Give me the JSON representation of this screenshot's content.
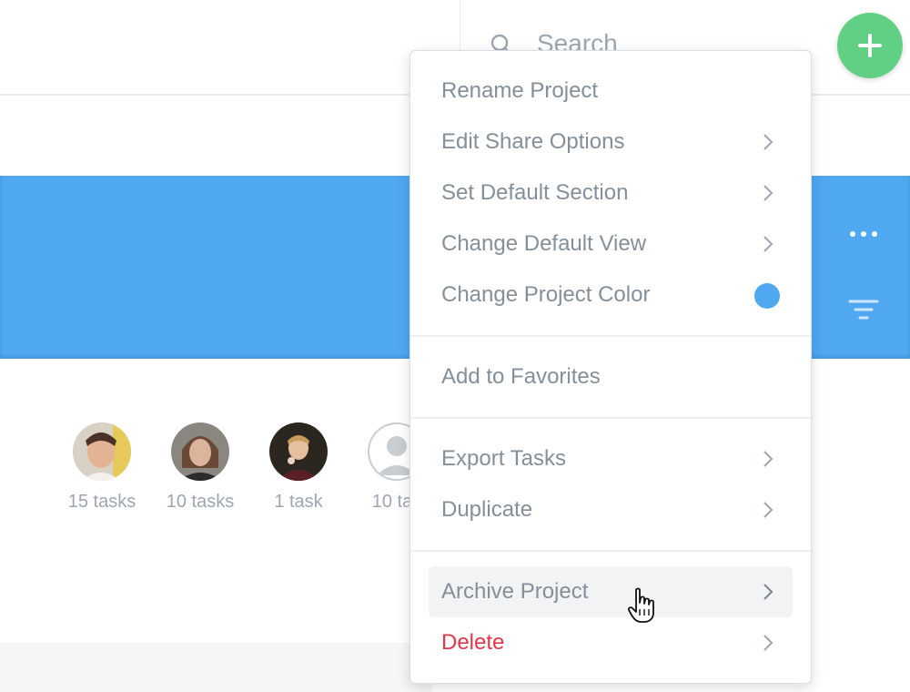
{
  "search": {
    "placeholder": "Search"
  },
  "members": [
    {
      "label": "15 tasks"
    },
    {
      "label": "10 tasks"
    },
    {
      "label": "1 task"
    },
    {
      "label": "10 tas"
    }
  ],
  "context_menu": {
    "rename": "Rename Project",
    "share": "Edit Share Options",
    "section": "Set Default Section",
    "view": "Change Default View",
    "color": "Change Project Color",
    "favorites": "Add to Favorites",
    "export": "Export Tasks",
    "duplicate": "Duplicate",
    "archive": "Archive Project",
    "delete": "Delete"
  },
  "colors": {
    "project_color": "#4fa8f0",
    "fab": "#62d084",
    "danger": "#e0384a",
    "menu_text": "#848f99"
  },
  "icons": [
    "search-icon",
    "plus-icon",
    "more-icon",
    "filter-icon",
    "chevron-right-icon",
    "hand-pointer-icon"
  ]
}
